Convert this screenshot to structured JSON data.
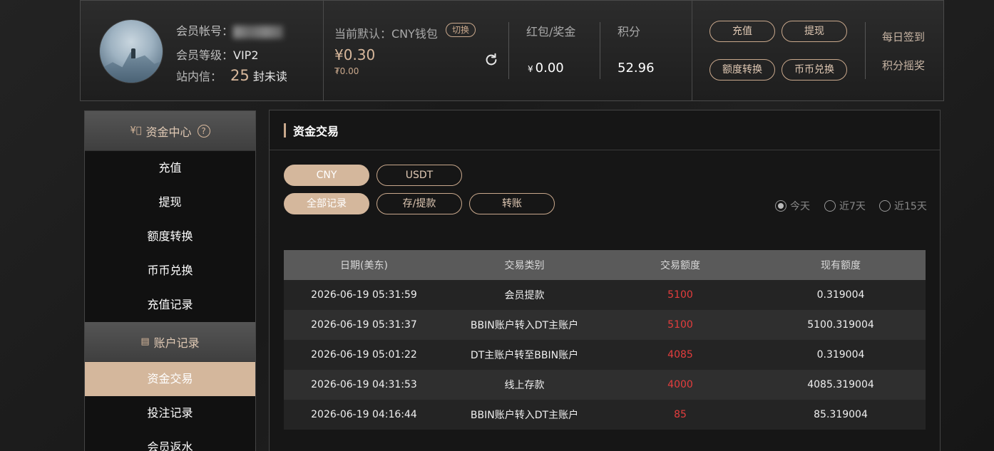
{
  "header": {
    "account_label": "会员帐号：",
    "level_label": "会员等级：",
    "level_value": "VIP2",
    "inbox_label": "站内信：",
    "unread_count": "25",
    "unread_suffix": "封未读",
    "wallet_label": "当前默认：CNY钱包",
    "switch_label": "切换",
    "wallet_amount": "¥0.30",
    "wallet_sub": "₮0.00",
    "bonus_label": "红包/奖金",
    "bonus_currency": "¥",
    "bonus_value": "0.00",
    "points_label": "积分",
    "points_value": "52.96",
    "actions": [
      "充值",
      "提现",
      "额度转换",
      "币币兑换"
    ],
    "daily_signin": "每日签到",
    "points_lottery": "积分摇奖"
  },
  "sidebar": {
    "fund_center": "资金中心",
    "fund_items": [
      "充值",
      "提现",
      "额度转换",
      "币币兑换",
      "充值记录"
    ],
    "account_records": "账户记录",
    "record_items": [
      "资金交易",
      "投注记录",
      "会员返水"
    ],
    "active_item": "资金交易"
  },
  "main": {
    "title": "资金交易",
    "currency_tabs": [
      "CNY",
      "USDT"
    ],
    "type_tabs": [
      "全部记录",
      "存/提款",
      "转账"
    ],
    "date_filters": [
      "今天",
      "近7天",
      "近15天"
    ],
    "table": {
      "headers": [
        "日期(美东)",
        "交易类别",
        "交易额度",
        "现有额度"
      ],
      "rows": [
        [
          "2026-06-19 05:31:59",
          "会员提款",
          "5100",
          "0.319004"
        ],
        [
          "2026-06-19 05:31:37",
          "BBIN账户转入DT主账户",
          "5100",
          "5100.319004"
        ],
        [
          "2026-06-19 05:01:22",
          "DT主账户转至BBIN账户",
          "4085",
          "0.319004"
        ],
        [
          "2026-06-19 04:31:53",
          "线上存款",
          "4000",
          "4085.319004"
        ],
        [
          "2026-06-19 04:16:44",
          "BBIN账户转入DT主账户",
          "85",
          "85.319004"
        ]
      ]
    }
  },
  "colors": {
    "accent": "#d4b79c",
    "amount": "#e43d3d"
  }
}
